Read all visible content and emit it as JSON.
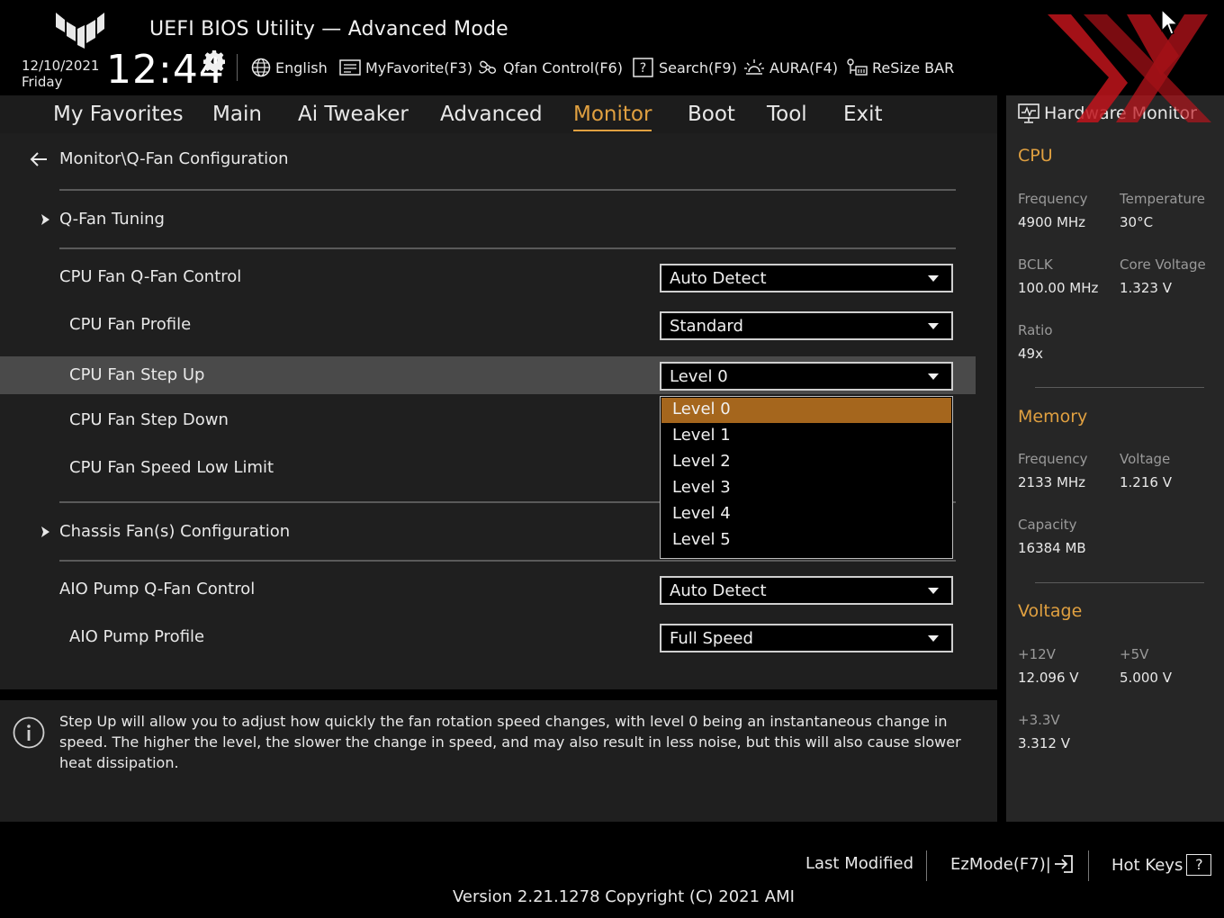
{
  "header": {
    "app_title": "UEFI BIOS Utility — Advanced Mode",
    "date": "12/10/2021",
    "day": "Friday",
    "time": "12:44",
    "toolbar": {
      "language": "English",
      "my_favorite": "MyFavorite(F3)",
      "qfan_control": "Qfan Control(F6)",
      "search": "Search(F9)",
      "aura": "AURA(F4)",
      "resize_bar": "ReSize BAR"
    }
  },
  "nav": {
    "tabs": [
      "My Favorites",
      "Main",
      "Ai Tweaker",
      "Advanced",
      "Monitor",
      "Boot",
      "Tool",
      "Exit"
    ],
    "active": "Monitor"
  },
  "main": {
    "breadcrumb": "Monitor\\Q-Fan Configuration",
    "q_fan_tuning": "Q-Fan Tuning",
    "cpu_fan_qfan_control": {
      "label": "CPU Fan Q-Fan Control",
      "value": "Auto Detect"
    },
    "cpu_fan_profile": {
      "label": "CPU Fan Profile",
      "value": "Standard"
    },
    "cpu_fan_step_up": {
      "label": "CPU Fan Step Up",
      "value": "Level 0"
    },
    "cpu_fan_step_down": {
      "label": "CPU Fan Step Down"
    },
    "cpu_fan_speed_low_limit": {
      "label": "CPU Fan Speed Low Limit"
    },
    "chassis_fans": "Chassis Fan(s) Configuration",
    "aio_pump_qfan_control": {
      "label": "AIO Pump Q-Fan Control",
      "value": "Auto Detect"
    },
    "aio_pump_profile": {
      "label": "AIO Pump Profile",
      "value": "Full Speed"
    },
    "dropdown_options": [
      "Level 0",
      "Level 1",
      "Level 2",
      "Level 3",
      "Level 4",
      "Level 5"
    ],
    "highlighted_option": "Level 0"
  },
  "help": {
    "text": "Step Up will allow you to adjust how quickly the fan rotation speed changes, with level 0 being an instantaneous change in speed. The higher the level, the slower the change in speed, and may also result in less noise, but this will also cause slower heat dissipation."
  },
  "hw_monitor": {
    "title": "Hardware Monitor",
    "cpu": {
      "heading": "CPU",
      "frequency_label": "Frequency",
      "frequency": "4900 MHz",
      "temperature_label": "Temperature",
      "temperature": "30°C",
      "bclk_label": "BCLK",
      "bclk": "100.00 MHz",
      "core_voltage_label": "Core Voltage",
      "core_voltage": "1.323 V",
      "ratio_label": "Ratio",
      "ratio": "49x"
    },
    "memory": {
      "heading": "Memory",
      "frequency_label": "Frequency",
      "frequency": "2133 MHz",
      "voltage_label": "Voltage",
      "voltage": "1.216 V",
      "capacity_label": "Capacity",
      "capacity": "16384 MB"
    },
    "voltage": {
      "heading": "Voltage",
      "v12_label": "+12V",
      "v12": "12.096 V",
      "v5_label": "+5V",
      "v5": "5.000 V",
      "v33_label": "+3.3V",
      "v33": "3.312 V"
    }
  },
  "footer": {
    "last_modified": "Last Modified",
    "ezmode": "EzMode(F7)|",
    "hot_keys": "Hot Keys",
    "hot_keys_key": "?",
    "version": "Version 2.21.1278 Copyright (C) 2021 AMI"
  },
  "colors": {
    "accent": "#e0a040",
    "selection": "#a5661d",
    "watermark": "#c0141c"
  }
}
